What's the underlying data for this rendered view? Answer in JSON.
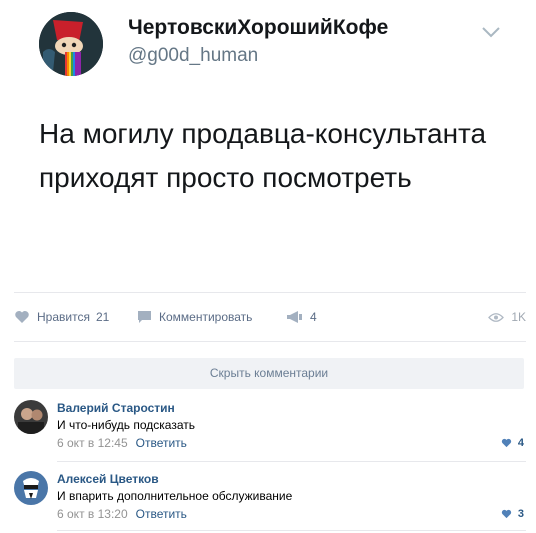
{
  "tweet": {
    "display_name": "ЧертовскиХорошийКофе",
    "handle": "@g00d_human",
    "text": "На могилу продавца-консультанта приходят просто посмотреть"
  },
  "actions": {
    "like_label": "Нравится",
    "like_count": "21",
    "comment_label": "Комментировать",
    "share_count": "4",
    "views": "1K"
  },
  "hide_comments_label": "Скрыть комментарии",
  "comments": [
    {
      "author": "Валерий Старостин",
      "text": "И что-нибудь подсказать",
      "time": "6 окт в 12:45",
      "reply_label": "Ответить",
      "likes": "4"
    },
    {
      "author": "Алексей Цветков",
      "text": "И впарить дополнительное обслуживание",
      "time": "6 окт в 13:20",
      "reply_label": "Ответить",
      "likes": "3"
    }
  ],
  "colors": {
    "link": "#2a5885",
    "muted": "#939393",
    "tweet_handle": "#657786"
  },
  "icons": [
    "heart-icon",
    "comment-icon",
    "megaphone-icon",
    "eye-icon",
    "chevron-down-icon"
  ]
}
